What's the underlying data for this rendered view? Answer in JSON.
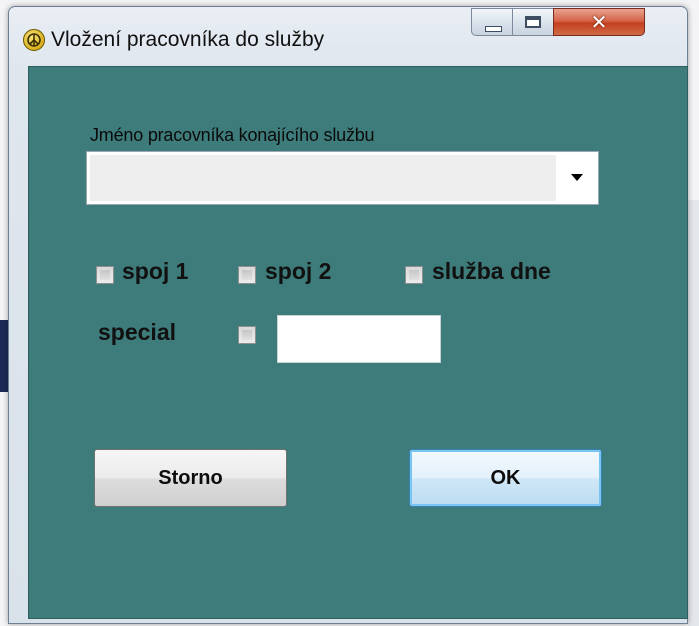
{
  "window": {
    "title": "Vložení pracovníka do služby",
    "icon": "peace-sign-icon",
    "caption_buttons": {
      "minimize": "minimize-icon",
      "maximize": "maximize-icon",
      "close": "✕"
    }
  },
  "form": {
    "worker_label": "Jméno pracovníka konajícího službu",
    "worker_select_value": "",
    "checkboxes": [
      {
        "label": "spoj 1",
        "checked": false
      },
      {
        "label": "spoj 2",
        "checked": false
      },
      {
        "label": "služba dne",
        "checked": false
      }
    ],
    "special": {
      "label": "special",
      "checked": false,
      "value": ""
    }
  },
  "buttons": {
    "cancel": "Storno",
    "ok": "OK"
  },
  "colors": {
    "client_background": "#3d7c7a",
    "ok_focus": "#77c7f2",
    "close_button": "#c4401f"
  }
}
